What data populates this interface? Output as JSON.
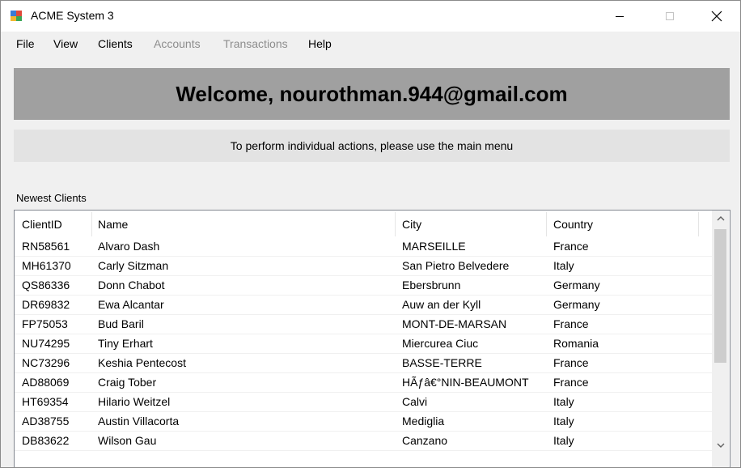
{
  "window": {
    "title": "ACME System 3",
    "controls": {
      "minimize_icon": "minimize-icon",
      "maximize_icon": "maximize-icon",
      "close_icon": "close-icon"
    }
  },
  "menu": {
    "file": "File",
    "view": "View",
    "clients": "Clients",
    "accounts": "Accounts",
    "transactions": "Transactions",
    "help": "Help"
  },
  "welcome": {
    "text": "Welcome, nourothman.944@gmail.com"
  },
  "info": {
    "text": "To perform individual actions, please use the main menu"
  },
  "clients_section": {
    "label": "Newest Clients",
    "columns": {
      "client_id": "ClientID",
      "name": "Name",
      "city": "City",
      "country": "Country"
    },
    "rows": [
      {
        "client_id": "RN58561",
        "name": "Alvaro Dash",
        "city": "MARSEILLE",
        "country": "France"
      },
      {
        "client_id": "MH61370",
        "name": "Carly Sitzman",
        "city": "San Pietro Belvedere",
        "country": "Italy"
      },
      {
        "client_id": "QS86336",
        "name": "Donn Chabot",
        "city": "Ebersbrunn",
        "country": "Germany"
      },
      {
        "client_id": "DR69832",
        "name": "Ewa Alcantar",
        "city": "Auw an der Kyll",
        "country": "Germany"
      },
      {
        "client_id": "FP75053",
        "name": "Bud Baril",
        "city": "MONT-DE-MARSAN",
        "country": "France"
      },
      {
        "client_id": "NU74295",
        "name": "Tiny Erhart",
        "city": "Miercurea Ciuc",
        "country": "Romania"
      },
      {
        "client_id": "NC73296",
        "name": "Keshia Pentecost",
        "city": "BASSE-TERRE",
        "country": "France"
      },
      {
        "client_id": "AD88069",
        "name": "Craig Tober",
        "city": "HÃƒâ€°NIN-BEAUMONT",
        "country": "France"
      },
      {
        "client_id": "HT69354",
        "name": "Hilario Weitzel",
        "city": "Calvi",
        "country": "Italy"
      },
      {
        "client_id": "AD38755",
        "name": "Austin Villacorta",
        "city": "Mediglia",
        "country": "Italy"
      },
      {
        "client_id": "DB83622",
        "name": "Wilson Gau",
        "city": "Canzano",
        "country": "Italy"
      }
    ]
  }
}
